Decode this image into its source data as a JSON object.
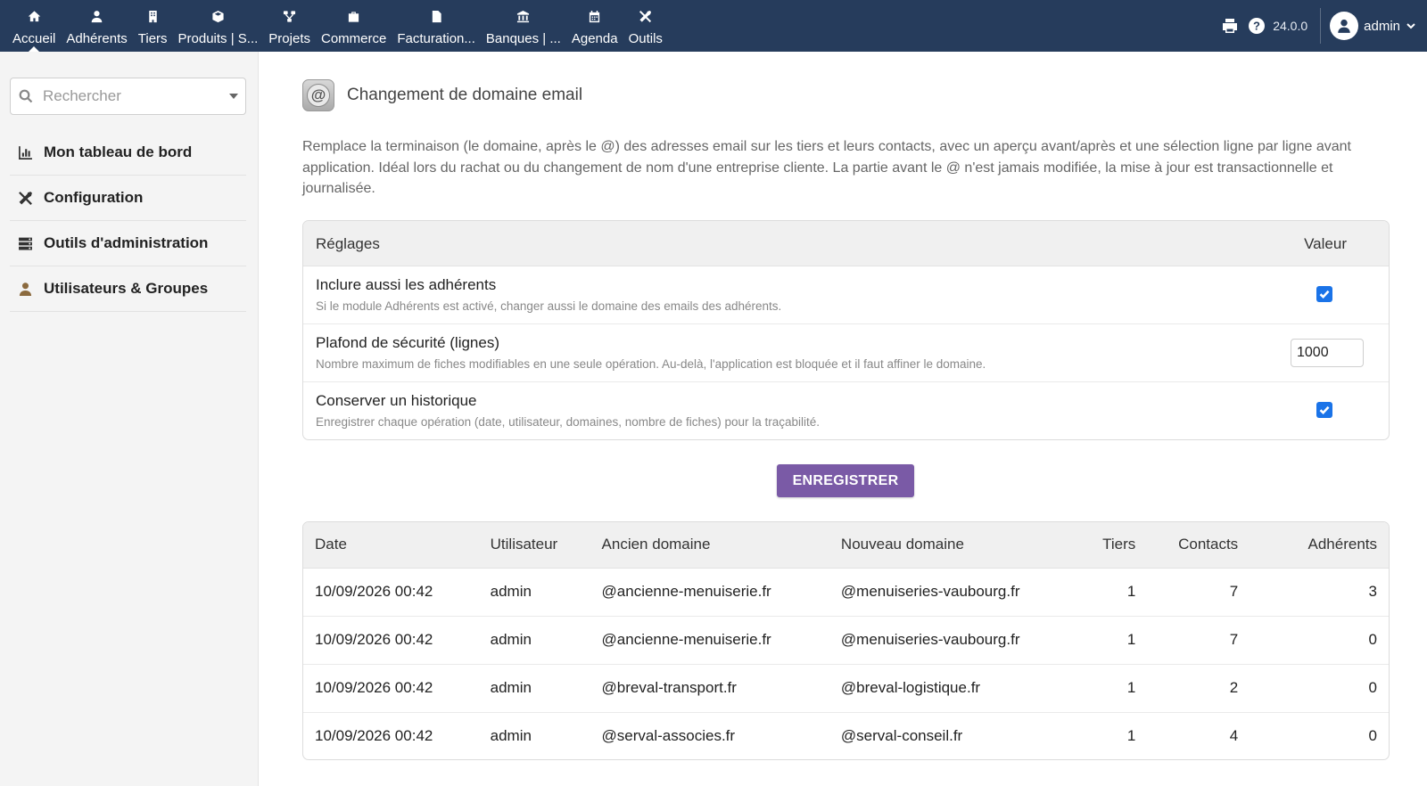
{
  "topnav": {
    "items": [
      {
        "label": "Accueil",
        "icon": "home-icon",
        "active": true
      },
      {
        "label": "Adhérents",
        "icon": "member-icon"
      },
      {
        "label": "Tiers",
        "icon": "building-icon"
      },
      {
        "label": "Produits | S...",
        "icon": "cube-icon"
      },
      {
        "label": "Projets",
        "icon": "project-icon"
      },
      {
        "label": "Commerce",
        "icon": "briefcase-icon"
      },
      {
        "label": "Facturation...",
        "icon": "invoice-icon"
      },
      {
        "label": "Banques | ...",
        "icon": "bank-icon"
      },
      {
        "label": "Agenda",
        "icon": "calendar-icon"
      },
      {
        "label": "Outils",
        "icon": "tools-icon"
      }
    ],
    "version": "24.0.0",
    "user": "admin"
  },
  "sidebar": {
    "search_placeholder": "Rechercher",
    "items": [
      {
        "label": "Mon tableau de bord",
        "icon": "chart-icon"
      },
      {
        "label": "Configuration",
        "icon": "tools-icon"
      },
      {
        "label": "Outils d'administration",
        "icon": "server-icon"
      },
      {
        "label": "Utilisateurs & Groupes",
        "icon": "user-icon"
      }
    ]
  },
  "page": {
    "title": "Changement de domaine email",
    "icon_glyph": "@",
    "description": "Remplace la terminaison (le domaine, après le @) des adresses email sur les tiers et leurs contacts, avec un aperçu avant/après et une sélection ligne par ligne avant application. Idéal lors du rachat ou du changement de nom d'une entreprise cliente. La partie avant le @ n'est jamais modifiée, la mise à jour est transactionnelle et journalisée."
  },
  "settings": {
    "header_label": "Réglages",
    "header_value": "Valeur",
    "rows": [
      {
        "label": "Inclure aussi les adhérents",
        "help": "Si le module Adhérents est activé, changer aussi le domaine des emails des adhérents.",
        "checked": true
      },
      {
        "label": "Plafond de sécurité (lignes)",
        "help": "Nombre maximum de fiches modifiables en une seule opération. Au-delà, l'application est bloquée et il faut affiner le domaine.",
        "value": "1000"
      },
      {
        "label": "Conserver un historique",
        "help": "Enregistrer chaque opération (date, utilisateur, domaines, nombre de fiches) pour la traçabilité.",
        "checked": true
      }
    ],
    "save_label": "ENREGISTRER"
  },
  "history": {
    "columns": [
      "Date",
      "Utilisateur",
      "Ancien domaine",
      "Nouveau domaine",
      "Tiers",
      "Contacts",
      "Adhérents"
    ],
    "rows": [
      [
        "10/09/2026 00:42",
        "admin",
        "@ancienne-menuiserie.fr",
        "@menuiseries-vaubourg.fr",
        "1",
        "7",
        "3"
      ],
      [
        "10/09/2026 00:42",
        "admin",
        "@ancienne-menuiserie.fr",
        "@menuiseries-vaubourg.fr",
        "1",
        "7",
        "0"
      ],
      [
        "10/09/2026 00:42",
        "admin",
        "@breval-transport.fr",
        "@breval-logistique.fr",
        "1",
        "2",
        "0"
      ],
      [
        "10/09/2026 00:42",
        "admin",
        "@serval-associes.fr",
        "@serval-conseil.fr",
        "1",
        "4",
        "0"
      ]
    ]
  },
  "colors": {
    "topbar": "#263c5c",
    "button": "#7a5aa6",
    "checkbox": "#1a73e8"
  }
}
